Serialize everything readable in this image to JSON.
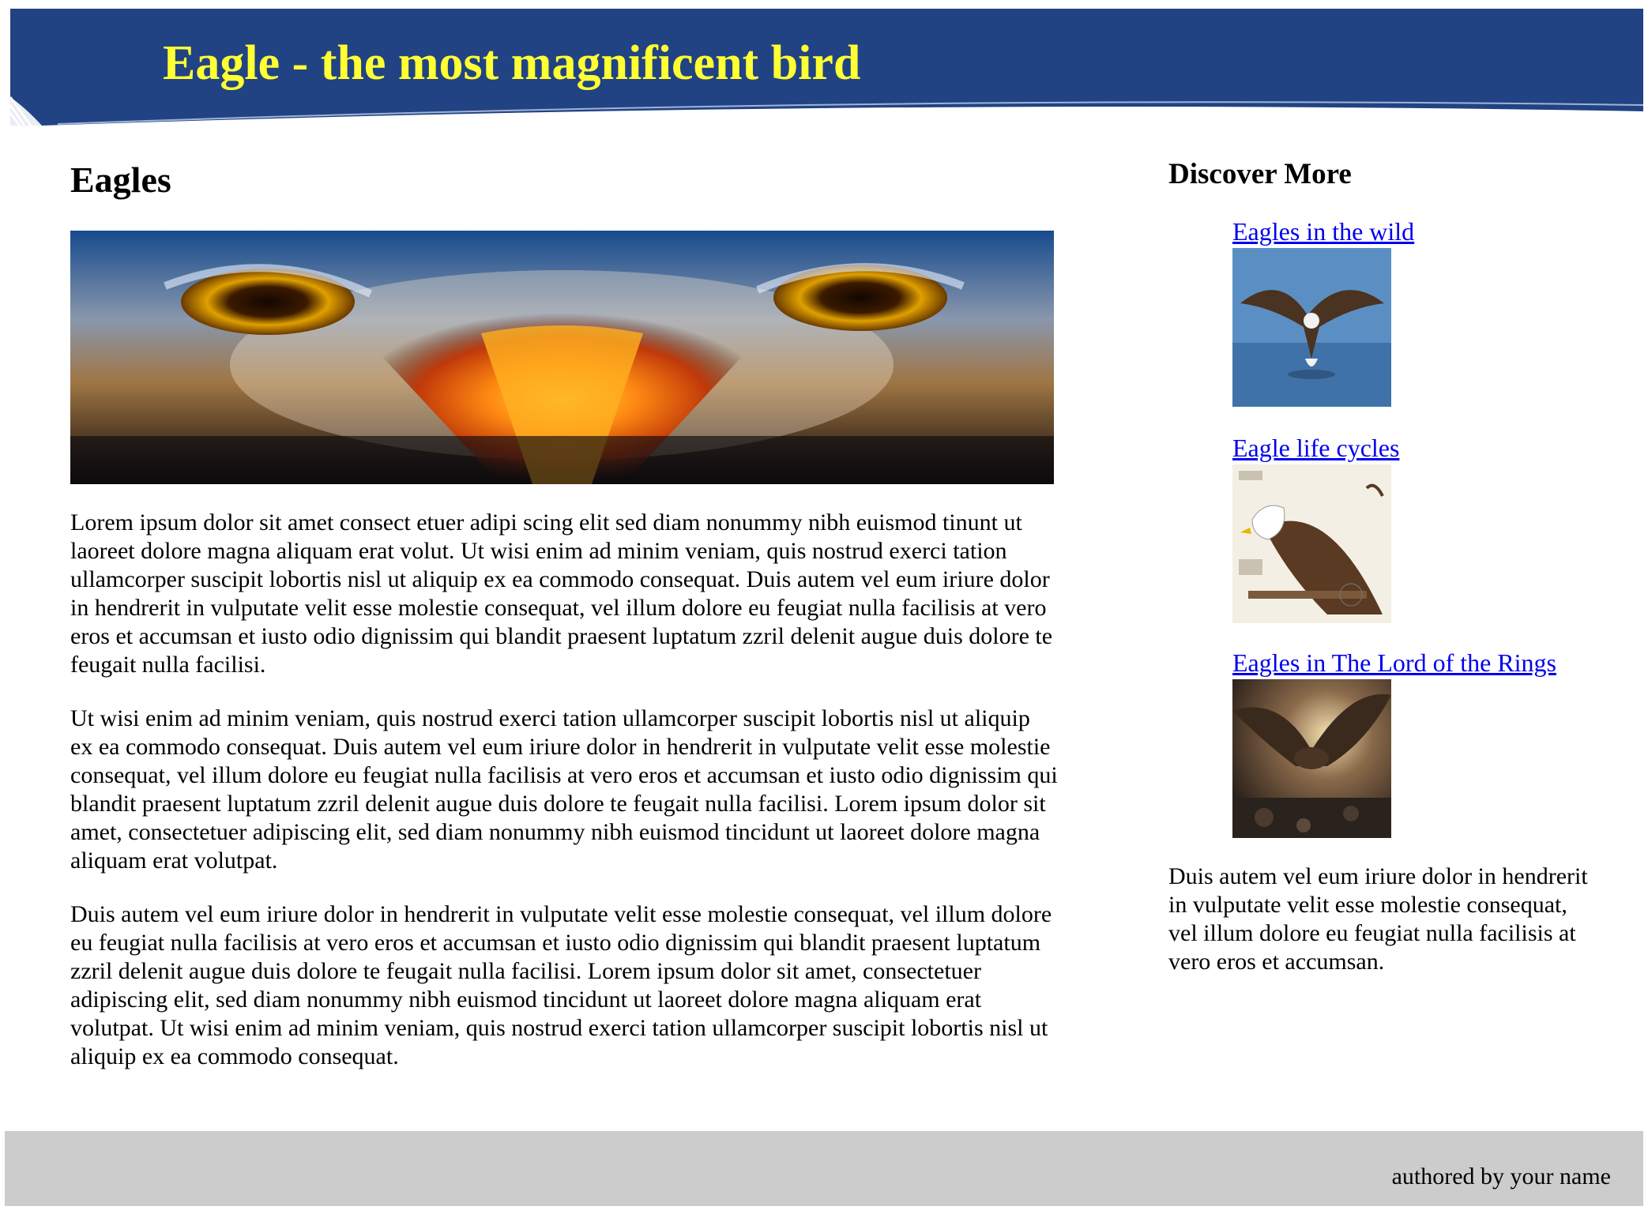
{
  "header": {
    "title": "Eagle - the most magnificent bird",
    "background_color": "#214383",
    "title_color": "#ffff33"
  },
  "main": {
    "heading": "Eagles",
    "hero_image": "eagle-eyes-fire-banner",
    "paragraphs": [
      "Lorem ipsum dolor sit amet consect etuer adipi scing elit sed diam nonummy nibh euismod tinunt ut laoreet dolore magna aliquam erat volut. Ut wisi enim ad minim veniam, quis nostrud exerci tation ullamcorper suscipit lobortis nisl ut aliquip ex ea commodo consequat. Duis autem vel eum iriure dolor in hendrerit in vulputate velit esse molestie consequat, vel illum dolore eu feugiat nulla facilisis at vero eros et accumsan et iusto odio dignissim qui blandit praesent luptatum zzril delenit augue duis dolore te feugait nulla facilisi.",
      "Ut wisi enim ad minim veniam, quis nostrud exerci tation ullamcorper suscipit lobortis nisl ut aliquip ex ea commodo consequat. Duis autem vel eum iriure dolor in hendrerit in vulputate velit esse molestie consequat, vel illum dolore eu feugiat nulla facilisis at vero eros et accumsan et iusto odio dignissim qui blandit praesent luptatum zzril delenit augue duis dolore te feugait nulla facilisi. Lorem ipsum dolor sit amet, consectetuer adipiscing elit, sed diam nonummy nibh euismod tincidunt ut laoreet dolore magna aliquam erat volutpat.",
      "Duis autem vel eum iriure dolor in hendrerit in vulputate velit esse molestie consequat, vel illum dolore eu feugiat nulla facilisis at vero eros et accumsan et iusto odio dignissim qui blandit praesent luptatum zzril delenit augue duis dolore te feugait nulla facilisi. Lorem ipsum dolor sit amet, consectetuer adipiscing elit, sed diam nonummy nibh euismod tincidunt ut laoreet dolore magna aliquam erat volutpat. Ut wisi enim ad minim veniam, quis nostrud exerci tation ullamcorper suscipit lobortis nisl ut aliquip ex ea commodo consequat."
    ]
  },
  "sidebar": {
    "heading": "Discover More",
    "items": [
      {
        "label": "Eagles in the wild",
        "image": "eagle-over-water-photo"
      },
      {
        "label": "Eagle life cycles",
        "image": "eagle-anatomy-illustration"
      },
      {
        "label": "Eagles in The Lord of the Rings",
        "image": "eagle-battle-scene"
      }
    ],
    "text": "Duis autem vel eum iriure dolor in hendrerit in vulputate velit esse molestie consequat, vel illum dolore eu feugiat nulla facilisis at vero eros et accumsan."
  },
  "footer": {
    "credit": "authored by your name",
    "background_color": "#cccccc"
  },
  "colors": {
    "link": "#0000ee"
  }
}
